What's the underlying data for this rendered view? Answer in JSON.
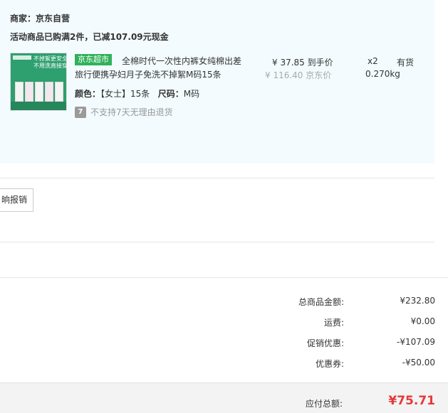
{
  "order": {
    "merchant": "商家：京东自营",
    "promo": "活动商品已购满2件，已减107.09元现金",
    "product": {
      "thumb_line1": "不掉絮更安全",
      "thumb_line2": "不用洗直接穿",
      "tag": "京东超市",
      "title_line1": "全棉时代一次性内裤女纯棉出差",
      "title_line2": "旅行便携孕妇月子免洗不掉絮M码15条",
      "color_label": "颜色：",
      "color_value": "【女士】15条",
      "size_label": "尺码：",
      "size_value": "M码",
      "refund_icon": "7",
      "refund_text": "不支持7天无理由退货",
      "price_now": "¥ 37.85 到手价",
      "price_old": "¥ 116.40 京东价",
      "qty": "x2",
      "stock": "有货",
      "weight": "0.270kg"
    }
  },
  "report_button": "晌报销",
  "summary": {
    "rows": [
      {
        "label": "总商品金额:",
        "value": "¥232.80"
      },
      {
        "label": "运费:",
        "value": "¥0.00"
      },
      {
        "label": "促销优惠:",
        "value": "-¥107.09"
      },
      {
        "label": "优惠券:",
        "value": "-¥50.00"
      }
    ],
    "total_label": "应付总额:",
    "total_value": "¥75.71"
  },
  "colors": {
    "accent_red": "#e4393c",
    "tag_green": "#31b15a",
    "panel_bg": "#f3fbfe"
  }
}
